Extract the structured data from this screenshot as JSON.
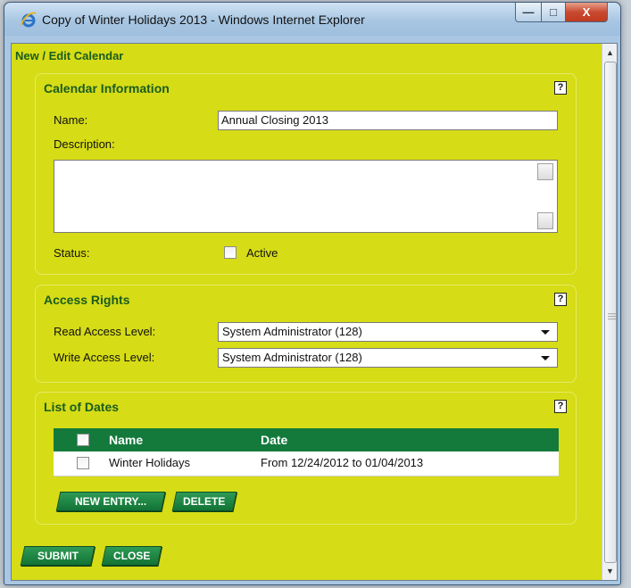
{
  "window": {
    "title": "Copy of Winter Holidays 2013 - Windows Internet Explorer",
    "minimize_glyph": "—",
    "maximize_glyph": "□",
    "close_glyph": "X"
  },
  "page": {
    "title": "New / Edit Calendar"
  },
  "calendar_info": {
    "section_title": "Calendar Information",
    "help_glyph": "?",
    "name_label": "Name:",
    "name_value": "Annual Closing 2013",
    "description_label": "Description:",
    "description_value": "",
    "status_label": "Status:",
    "active_label": "Active",
    "active_checked": false
  },
  "access_rights": {
    "section_title": "Access Rights",
    "help_glyph": "?",
    "read_label": "Read Access Level:",
    "read_value": "System Administrator (128)",
    "write_label": "Write Access Level:",
    "write_value": "System Administrator (128)"
  },
  "list_of_dates": {
    "section_title": "List of Dates",
    "help_glyph": "?",
    "columns": [
      "Name",
      "Date"
    ],
    "rows": [
      {
        "name": "Winter Holidays",
        "date": "From 12/24/2012 to 01/04/2013",
        "checked": false
      }
    ],
    "new_entry_label": "NEW ENTRY...",
    "delete_label": "DELETE"
  },
  "footer": {
    "submit_label": "SUBMIT",
    "close_label": "CLOSE"
  },
  "colors": {
    "panel": "#d6dc16",
    "heading": "#1a5c1f",
    "table_header": "#137a3c",
    "button": "#127335"
  },
  "icons": [
    "ie-logo-icon",
    "help-icon",
    "dropdown-arrow-icon",
    "scroll-up-icon",
    "scroll-down-icon"
  ]
}
